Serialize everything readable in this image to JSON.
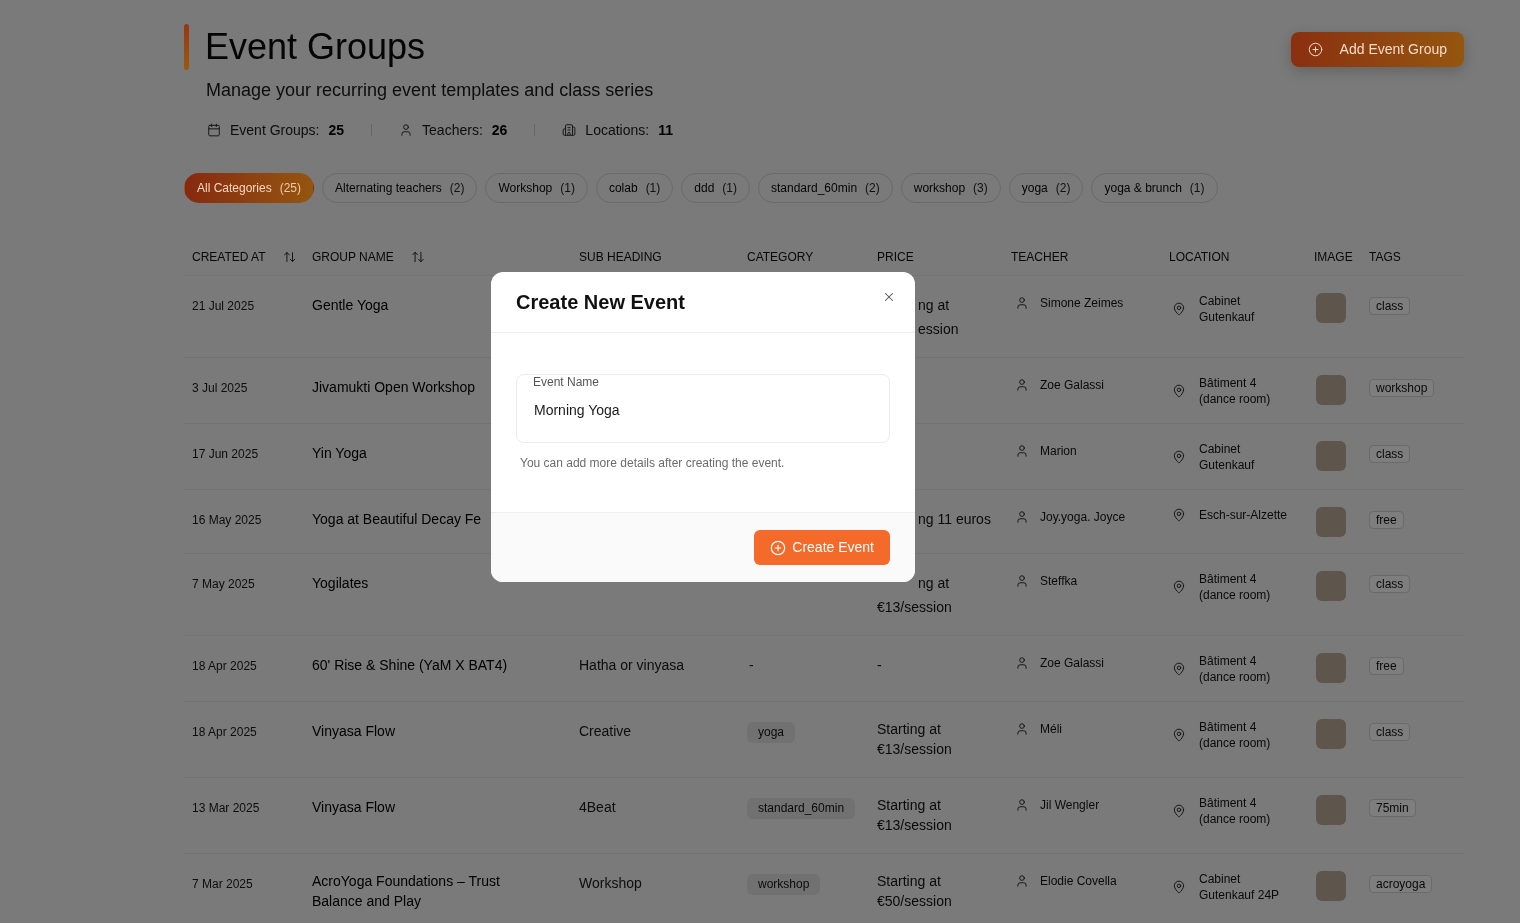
{
  "header": {
    "title": "Event Groups",
    "subtitle": "Manage your recurring event templates and class series",
    "add_button": "Add Event Group"
  },
  "stats": [
    {
      "kind": "groups",
      "label": "Event Groups:",
      "value": "25"
    },
    {
      "kind": "teachers",
      "label": "Teachers:",
      "value": "26"
    },
    {
      "kind": "locations",
      "label": "Locations:",
      "value": "11"
    }
  ],
  "categories": [
    {
      "label": "All Categories",
      "count": "(25)",
      "selected": true
    },
    {
      "label": "Alternating teachers",
      "count": "(2)",
      "selected": false
    },
    {
      "label": "Workshop",
      "count": "(1)",
      "selected": false
    },
    {
      "label": "colab",
      "count": "(1)",
      "selected": false
    },
    {
      "label": "ddd",
      "count": "(1)",
      "selected": false
    },
    {
      "label": "standard_60min",
      "count": "(2)",
      "selected": false
    },
    {
      "label": "workshop",
      "count": "(3)",
      "selected": false
    },
    {
      "label": "yoga",
      "count": "(2)",
      "selected": false
    },
    {
      "label": "yoga & brunch",
      "count": "(1)",
      "selected": false
    }
  ],
  "table": {
    "columns": [
      {
        "label": "CREATED AT",
        "sortable": true
      },
      {
        "label": "GROUP NAME",
        "sortable": true
      },
      {
        "label": "SUB HEADING",
        "sortable": false
      },
      {
        "label": "CATEGORY",
        "sortable": false
      },
      {
        "label": "PRICE",
        "sortable": false
      },
      {
        "label": "TEACHER",
        "sortable": false
      },
      {
        "label": "LOCATION",
        "sortable": false
      },
      {
        "label": "IMAGE",
        "sortable": false
      },
      {
        "label": "TAGS",
        "sortable": false
      }
    ],
    "rows": [
      {
        "created_at": "21 Jul 2025",
        "group_name": "Gentle Yoga",
        "price": "ng at\nession",
        "teacher": "Simone Zeimes",
        "location": "Cabinet Gutenkauf",
        "tag": "class"
      },
      {
        "created_at": "3 Jul 2025",
        "group_name": "Jivamukti Open Workshop",
        "teacher": "Zoe Galassi",
        "location": "Bâtiment 4 (dance room)",
        "tag": "workshop"
      },
      {
        "created_at": "17 Jun 2025",
        "group_name": "Yin Yoga",
        "teacher": "Marion",
        "location": "Cabinet Gutenkauf",
        "tag": "class"
      },
      {
        "created_at": "16 May 2025",
        "group_name": "Yoga at Beautiful Decay Fe",
        "price": "ng 11 euros",
        "teacher": "Joy.yoga. Joyce",
        "location": "Esch-sur-Alzette",
        "tag": "free"
      },
      {
        "created_at": "7 May 2025",
        "group_name": "Yogilates",
        "price": "ng at\n€13/session",
        "teacher": "Steffka",
        "location": "Bâtiment 4 (dance room)",
        "tag": "class"
      },
      {
        "created_at": "18 Apr 2025",
        "group_name": "60' Rise & Shine (YaM X BAT4)",
        "sub_heading": "Hatha or vinyasa",
        "category": {
          "kind": "empty",
          "label": "-"
        },
        "price": "-",
        "teacher": "Zoe Galassi",
        "location": "Bâtiment 4 (dance room)",
        "tag": "free"
      },
      {
        "created_at": "18 Apr 2025",
        "group_name": "Vinyasa Flow",
        "sub_heading": "Creative",
        "category": {
          "kind": "chip",
          "label": "yoga"
        },
        "price": "Starting at €13/session",
        "teacher": "Méli",
        "location": "Bâtiment 4 (dance room)",
        "tag": "class"
      },
      {
        "created_at": "13 Mar 2025",
        "group_name": "Vinyasa Flow",
        "sub_heading": "4Beat",
        "category": {
          "kind": "chip",
          "label": "standard_60min"
        },
        "price": "Starting at €13/session",
        "teacher": "Jil Wengler",
        "location": "Bâtiment 4 (dance room)",
        "tag": "75min"
      },
      {
        "created_at": "7 Mar 2025",
        "group_name": "AcroYoga Foundations – Trust Balance and Play",
        "sub_heading": "Workshop",
        "category": {
          "kind": "chip",
          "label": "workshop"
        },
        "price": "Starting at €50/session",
        "teacher": "Elodie Covella",
        "location": "Cabinet Gutenkauf 24P",
        "tag": "acroyoga"
      }
    ]
  },
  "dialog": {
    "title": "Create New Event",
    "field": {
      "label": "Event Name",
      "value": "Morning Yoga"
    },
    "hint": "You can add more details after creating the event.",
    "submit": "Create Event"
  }
}
